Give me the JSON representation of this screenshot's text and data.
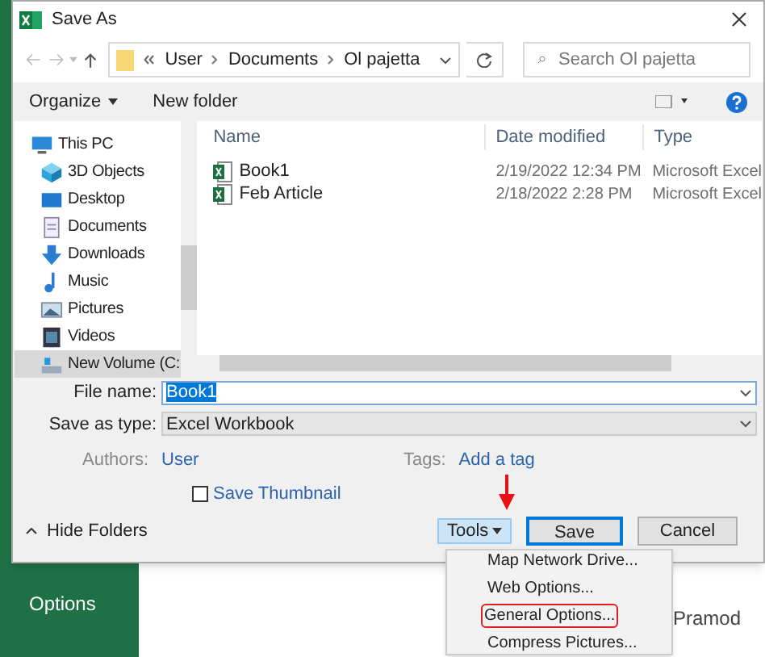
{
  "window": {
    "title": "Save As"
  },
  "address": {
    "path": [
      "User",
      "Documents",
      "Ol pajetta"
    ]
  },
  "search": {
    "placeholder": "Search Ol pajetta"
  },
  "toolbar": {
    "organize": "Organize",
    "new_folder": "New folder"
  },
  "sidebar": {
    "items": [
      {
        "label": "This PC",
        "kind": "pc",
        "selected": false,
        "children": [
          {
            "label": "3D Objects",
            "kind": "cube",
            "selected": false
          },
          {
            "label": "Desktop",
            "kind": "desktop",
            "selected": false
          },
          {
            "label": "Documents",
            "kind": "document",
            "selected": false
          },
          {
            "label": "Downloads",
            "kind": "download",
            "selected": false
          },
          {
            "label": "Music",
            "kind": "music",
            "selected": false
          },
          {
            "label": "Pictures",
            "kind": "pictures",
            "selected": false
          },
          {
            "label": "Videos",
            "kind": "videos",
            "selected": false
          },
          {
            "label": "New Volume (C:",
            "kind": "drive",
            "selected": true
          }
        ]
      }
    ]
  },
  "table": {
    "columns": [
      "Name",
      "Date modified",
      "Type"
    ],
    "rows": [
      {
        "name": "Book1",
        "date": "2/19/2022 12:34 PM",
        "type": "Microsoft Excel"
      },
      {
        "name": "Feb Article",
        "date": "2/18/2022 2:28 PM",
        "type": "Microsoft Excel"
      }
    ]
  },
  "form": {
    "file_name_label": "File name:",
    "file_name": "Book1",
    "type_label": "Save as type:",
    "type": "Excel Workbook",
    "authors_label": "Authors:",
    "authors": "User",
    "tags_label": "Tags:",
    "tags": "Add a tag",
    "thumbnail": {
      "label": "Save Thumbnail",
      "checked": false
    }
  },
  "footer": {
    "hide_folders": "Hide Folders",
    "tools": "Tools",
    "save": "Save",
    "cancel": "Cancel"
  },
  "tools_menu": [
    {
      "label": "Map Network Drive...",
      "circled": false
    },
    {
      "label": "Web Options...",
      "circled": false
    },
    {
      "label": "General Options...",
      "circled": true
    },
    {
      "label": "Compress Pictures...",
      "circled": false
    }
  ],
  "background": {
    "sidebar_item": "Options",
    "content_text": "Pramod"
  }
}
